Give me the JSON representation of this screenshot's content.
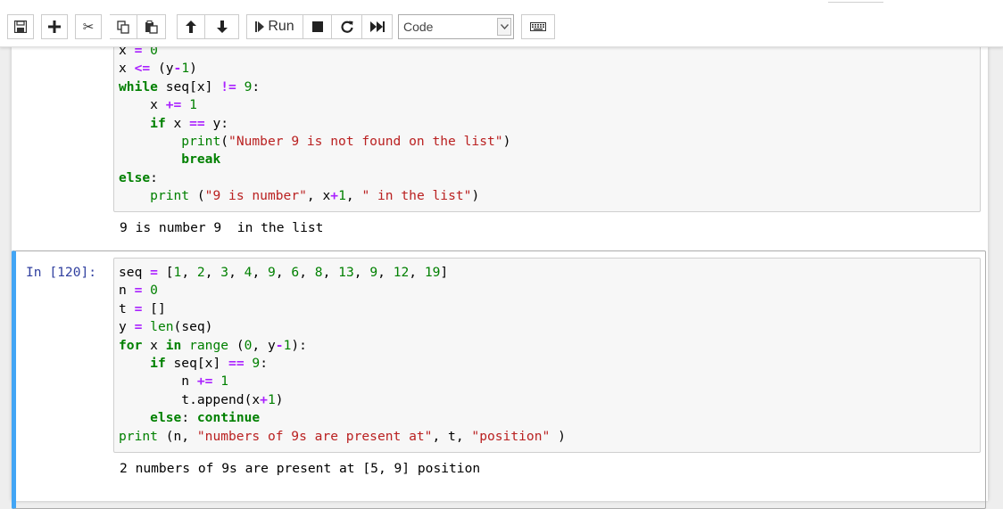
{
  "toolbar": {
    "run_label": "Run",
    "cell_type_selected": "Code",
    "buttons": [
      "save-icon",
      "plus-icon",
      "scissors-icon",
      "copy-icon",
      "paste-icon",
      "arrow-up-icon",
      "arrow-down-icon",
      "run-icon",
      "stop-icon",
      "restart-icon",
      "fast-forward-icon",
      "keyboard-icon"
    ]
  },
  "cell1": {
    "code_lines": [
      [
        [
          "txt",
          "x "
        ],
        [
          "op",
          "="
        ],
        [
          "txt",
          " "
        ],
        [
          "nu",
          "0"
        ]
      ],
      [
        [
          "txt",
          "x "
        ],
        [
          "op",
          "<="
        ],
        [
          "txt",
          " (y"
        ],
        [
          "op",
          "-"
        ],
        [
          "nu",
          "1"
        ],
        [
          "txt",
          ")"
        ]
      ],
      [
        [
          "kw",
          "while"
        ],
        [
          "txt",
          " seq[x] "
        ],
        [
          "op",
          "!="
        ],
        [
          "txt",
          " "
        ],
        [
          "nu",
          "9"
        ],
        [
          "txt",
          ":"
        ]
      ],
      [
        [
          "txt",
          "    x "
        ],
        [
          "op",
          "+="
        ],
        [
          "txt",
          " "
        ],
        [
          "nu",
          "1"
        ]
      ],
      [
        [
          "txt",
          "    "
        ],
        [
          "kw",
          "if"
        ],
        [
          "txt",
          " x "
        ],
        [
          "op",
          "=="
        ],
        [
          "txt",
          " y:"
        ]
      ],
      [
        [
          "txt",
          "        "
        ],
        [
          "bi",
          "print"
        ],
        [
          "txt",
          "("
        ],
        [
          "st",
          "\"Number 9 is not found on the list\""
        ],
        [
          "txt",
          ")"
        ]
      ],
      [
        [
          "txt",
          "        "
        ],
        [
          "kw",
          "break"
        ]
      ],
      [
        [
          "kw",
          "else"
        ],
        [
          "txt",
          ":"
        ]
      ],
      [
        [
          "txt",
          "    "
        ],
        [
          "bi",
          "print"
        ],
        [
          "txt",
          " ("
        ],
        [
          "st",
          "\"9 is number\""
        ],
        [
          "txt",
          ", x"
        ],
        [
          "op",
          "+"
        ],
        [
          "nu",
          "1"
        ],
        [
          "txt",
          ", "
        ],
        [
          "st",
          "\" in the list\""
        ],
        [
          "txt",
          ")"
        ]
      ]
    ],
    "output": "9 is number 9  in the list"
  },
  "cell2": {
    "prompt": "In [120]:",
    "code_lines": [
      [
        [
          "txt",
          "seq "
        ],
        [
          "op",
          "="
        ],
        [
          "txt",
          " ["
        ],
        [
          "nu",
          "1"
        ],
        [
          "txt",
          ", "
        ],
        [
          "nu",
          "2"
        ],
        [
          "txt",
          ", "
        ],
        [
          "nu",
          "3"
        ],
        [
          "txt",
          ", "
        ],
        [
          "nu",
          "4"
        ],
        [
          "txt",
          ", "
        ],
        [
          "nu",
          "9"
        ],
        [
          "txt",
          ", "
        ],
        [
          "nu",
          "6"
        ],
        [
          "txt",
          ", "
        ],
        [
          "nu",
          "8"
        ],
        [
          "txt",
          ", "
        ],
        [
          "nu",
          "13"
        ],
        [
          "txt",
          ", "
        ],
        [
          "nu",
          "9"
        ],
        [
          "txt",
          ", "
        ],
        [
          "nu",
          "12"
        ],
        [
          "txt",
          ", "
        ],
        [
          "nu",
          "19"
        ],
        [
          "txt",
          "]"
        ]
      ],
      [
        [
          "txt",
          "n "
        ],
        [
          "op",
          "="
        ],
        [
          "txt",
          " "
        ],
        [
          "nu",
          "0"
        ]
      ],
      [
        [
          "txt",
          "t "
        ],
        [
          "op",
          "="
        ],
        [
          "txt",
          " []"
        ]
      ],
      [
        [
          "txt",
          "y "
        ],
        [
          "op",
          "="
        ],
        [
          "txt",
          " "
        ],
        [
          "bi",
          "len"
        ],
        [
          "txt",
          "(seq)"
        ]
      ],
      [
        [
          "kw",
          "for"
        ],
        [
          "txt",
          " x "
        ],
        [
          "kw",
          "in"
        ],
        [
          "txt",
          " "
        ],
        [
          "bi",
          "range"
        ],
        [
          "txt",
          " ("
        ],
        [
          "nu",
          "0"
        ],
        [
          "txt",
          ", y"
        ],
        [
          "op",
          "-"
        ],
        [
          "nu",
          "1"
        ],
        [
          "txt",
          "):"
        ]
      ],
      [
        [
          "txt",
          "    "
        ],
        [
          "kw",
          "if"
        ],
        [
          "txt",
          " seq[x] "
        ],
        [
          "op",
          "=="
        ],
        [
          "txt",
          " "
        ],
        [
          "nu",
          "9"
        ],
        [
          "txt",
          ":"
        ]
      ],
      [
        [
          "txt",
          "        n "
        ],
        [
          "op",
          "+="
        ],
        [
          "txt",
          " "
        ],
        [
          "nu",
          "1"
        ]
      ],
      [
        [
          "txt",
          "        t.append(x"
        ],
        [
          "op",
          "+"
        ],
        [
          "nu",
          "1"
        ],
        [
          "txt",
          ")"
        ]
      ],
      [
        [
          "txt",
          "    "
        ],
        [
          "kw",
          "else"
        ],
        [
          "txt",
          ": "
        ],
        [
          "kw",
          "continue"
        ]
      ],
      [
        [
          "bi",
          "print"
        ],
        [
          "txt",
          " (n, "
        ],
        [
          "st",
          "\"numbers of 9s are present at\""
        ],
        [
          "txt",
          ", t, "
        ],
        [
          "st",
          "\"position\""
        ],
        [
          "txt",
          " )"
        ]
      ]
    ],
    "output": "2 numbers of 9s are present at [5, 9] position"
  }
}
